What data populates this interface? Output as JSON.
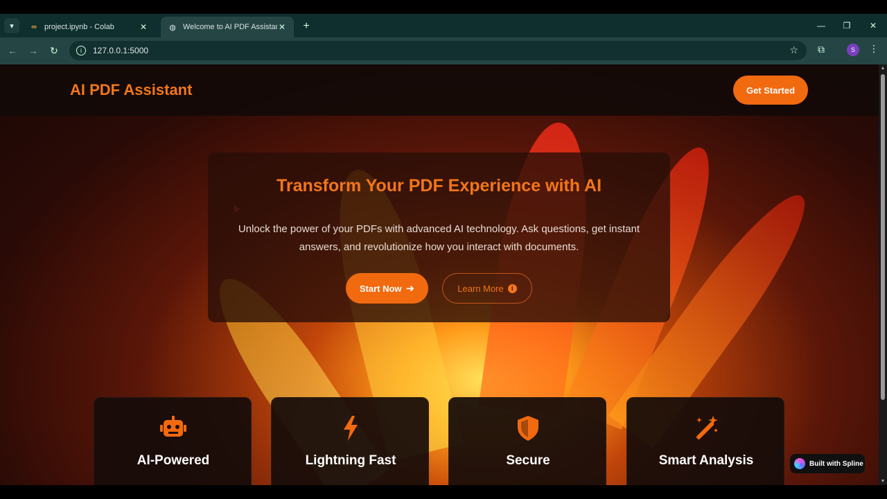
{
  "browser": {
    "tabs": [
      {
        "label": "project.ipynb - Colab",
        "icon": "colab-icon",
        "active": false
      },
      {
        "label": "Welcome to AI PDF Assistant",
        "icon": "globe-icon",
        "active": true
      }
    ],
    "url": "127.0.0.1:5000",
    "profile_initial": "S"
  },
  "nav": {
    "brand": "AI PDF Assistant",
    "cta_label": "Get Started"
  },
  "hero": {
    "title": "Transform Your PDF Experience with AI",
    "description": "Unlock the power of your PDFs with advanced AI technology. Ask questions, get instant answers, and revolutionize how you interact with documents.",
    "primary_label": "Start Now",
    "secondary_label": "Learn More"
  },
  "features": [
    {
      "title": "AI-Powered",
      "icon": "robot-icon"
    },
    {
      "title": "Lightning Fast",
      "icon": "bolt-icon"
    },
    {
      "title": "Secure",
      "icon": "shield-icon"
    },
    {
      "title": "Smart Analysis",
      "icon": "magic-wand-icon"
    }
  ],
  "badge": {
    "label": "Built with Spline"
  },
  "colors": {
    "accent": "#f26a0f",
    "brand_text": "#f2761a",
    "chrome": "#254544"
  }
}
